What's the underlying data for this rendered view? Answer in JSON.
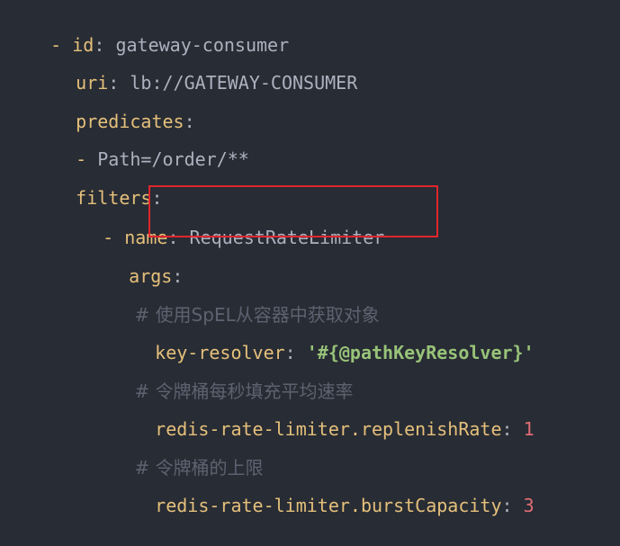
{
  "code": {
    "line1": {
      "dash": "- ",
      "key": "id",
      "sep": ": ",
      "value": "gateway-consumer"
    },
    "line2": {
      "key": "uri",
      "sep": ": ",
      "value": "lb://GATEWAY-CONSUMER"
    },
    "line3": {
      "key": "predicates",
      "sep": ":"
    },
    "line4": {
      "dash": "- ",
      "value": "Path=/order/**"
    },
    "line5": {
      "key": "filters",
      "sep": ":"
    },
    "line6": {
      "dash": "- ",
      "key": "name",
      "sep": ": ",
      "value": "RequestRateLimiter"
    },
    "line7": {
      "key": "args",
      "sep": ":"
    },
    "line8": {
      "hash": "# ",
      "text": "使用SpEL从容器中获取对象"
    },
    "line9": {
      "key": "key-resolver",
      "sep": ": ",
      "value": "'#{@pathKeyResolver}'"
    },
    "line10": {
      "hash": "# ",
      "text": "令牌桶每秒填充平均速率"
    },
    "line11": {
      "key": "redis-rate-limiter.replenishRate",
      "sep": ": ",
      "value": "1"
    },
    "line12": {
      "hash": "# ",
      "text": "令牌桶的上限"
    },
    "line13": {
      "key": "redis-rate-limiter.burstCapacity",
      "sep": ": ",
      "value": "3"
    }
  },
  "colors": {
    "background": "#282c34",
    "key": "#e5c07b",
    "string": "#98c379",
    "comment": "#5c6370",
    "number": "#e06c75",
    "highlight_border": "#e0262c"
  }
}
